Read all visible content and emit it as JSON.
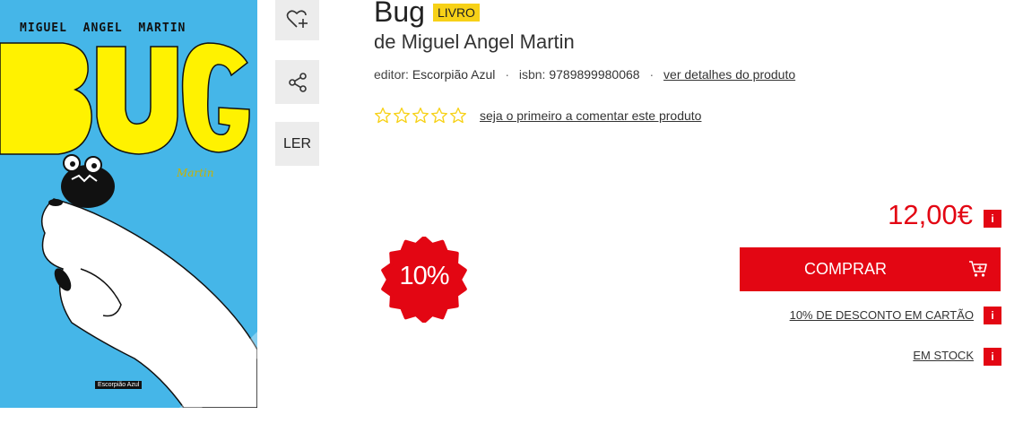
{
  "cover": {
    "author_text": "MIGUEL  ANGEL  MARTIN",
    "title_art": "BUG",
    "signature": "Martin",
    "publisher_tag": "Escorpião Azul"
  },
  "side_actions": {
    "wishlist_icon": "heart-plus-icon",
    "share_icon": "share-icon",
    "read_label": "LER"
  },
  "product": {
    "title": "Bug",
    "format_badge": "LIVRO",
    "author_line": "de Miguel Angel Martin",
    "editor_label": "editor:",
    "editor_value": "Escorpião Azul",
    "isbn_label": "isbn:",
    "isbn_value": "9789899980068",
    "details_link": "ver detalhes do produto",
    "stars_filled": 0,
    "stars_total": 5,
    "review_link": "seja o primeiro a comentar este produto"
  },
  "discount": {
    "badge_text": "10%"
  },
  "purchase": {
    "price": "12,00€",
    "info_label": "i",
    "buy_label": "COMPRAR",
    "card_discount_link": "10% DE DESCONTO EM CARTÃO",
    "stock_link": "EM STOCK"
  },
  "colors": {
    "accent_red": "#e30613",
    "badge_yellow": "#f7d117",
    "cover_blue": "#45b6e8",
    "cover_yellow": "#fff200"
  }
}
